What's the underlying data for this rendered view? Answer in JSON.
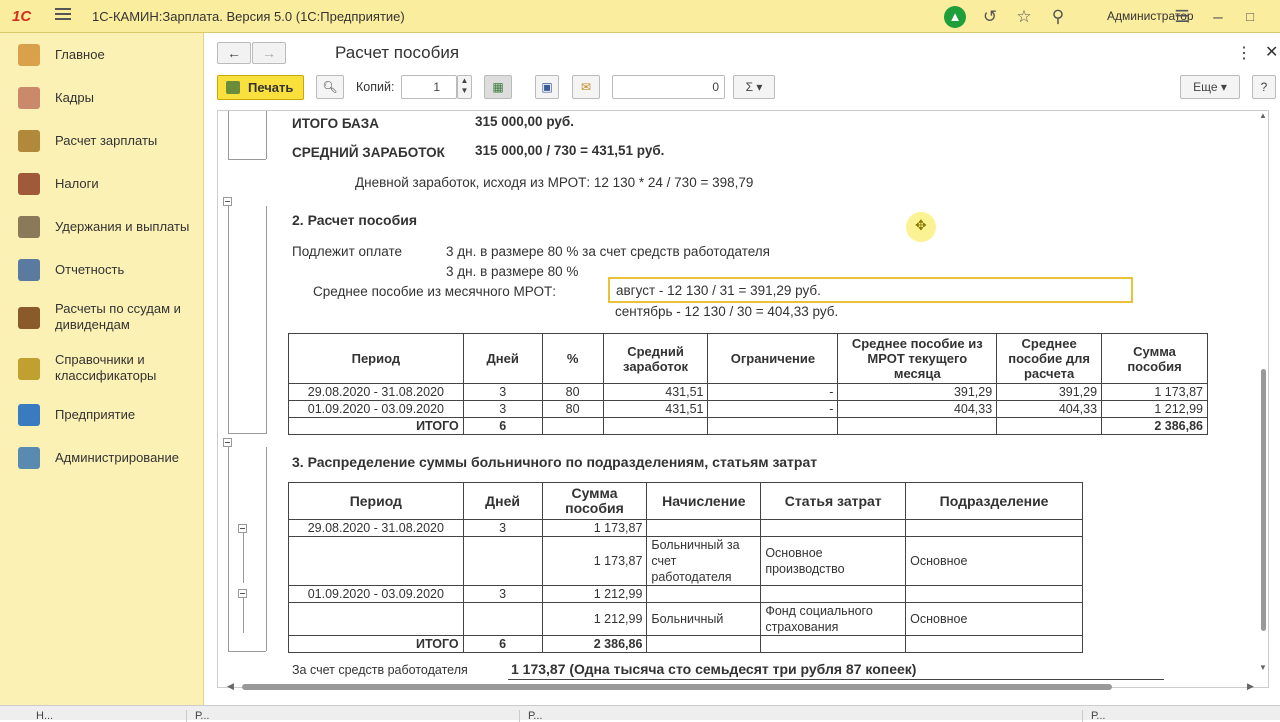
{
  "app": {
    "logo": "1С",
    "title": "1С-КАМИН:Зарплата. Версия 5.0  (1С:Предприятие)",
    "user": "Администратор"
  },
  "sidebar": {
    "items": [
      {
        "label": "Главное",
        "color": "#d9a24a"
      },
      {
        "label": "Кадры",
        "color": "#c9896a"
      },
      {
        "label": "Расчет зарплаты",
        "color": "#b08a3a"
      },
      {
        "label": "Налоги",
        "color": "#a05a3a"
      },
      {
        "label": "Удержания и выплаты",
        "color": "#8a7a5a"
      },
      {
        "label": "Отчетность",
        "color": "#5a7aa0"
      },
      {
        "label": "Расчеты по ссудам и дивидендам",
        "color": "#8a5a2a"
      },
      {
        "label": "Справочники и классификаторы",
        "color": "#c0a030"
      },
      {
        "label": "Предприятие",
        "color": "#3a7ac0"
      },
      {
        "label": "Администрирование",
        "color": "#5a8ab0"
      }
    ]
  },
  "form": {
    "title": "Расчет пособия",
    "print_label": "Печать",
    "copies_label": "Копий:",
    "copies_value": "1",
    "sum_value": "0",
    "more_label": "Еще",
    "help_label": "?"
  },
  "doc": {
    "base_label": "ИТОГО БАЗА",
    "base_value": "315 000,00  руб.",
    "avg_label": "СРЕДНИЙ ЗАРАБОТОК",
    "avg_value": "315 000,00  /  730  =  431,51  руб.",
    "daily": "Дневной заработок, исходя из МРОТ: 12 130 * 24 / 730 = 398,79",
    "sec2": "2. Расчет пособия",
    "pay_label": "Подлежит оплате",
    "pay_line1": "3 дн. в размере 80 % за счет средств работодателя",
    "pay_line2": "3 дн. в размере 80 %",
    "mrot_label": "Среднее пособие из месячного МРОТ:",
    "mrot_line1": "август - 12 130 / 31 = 391,29 руб.",
    "mrot_line2": "сентябрь - 12 130 / 30 = 404,33 руб.",
    "t1_headers": [
      "Период",
      "Дней",
      "%",
      "Средний заработок",
      "Ограничение",
      "Среднее пособие из МРОТ текущего месяца",
      "Среднее пособие для расчета",
      "Сумма пособия"
    ],
    "t1_rows": [
      [
        "29.08.2020 - 31.08.2020",
        "3",
        "80",
        "431,51",
        "-",
        "391,29",
        "391,29",
        "1 173,87"
      ],
      [
        "01.09.2020 - 03.09.2020",
        "3",
        "80",
        "431,51",
        "-",
        "404,33",
        "404,33",
        "1 212,99"
      ]
    ],
    "t1_total": {
      "label": "ИТОГО",
      "days": "6",
      "sum": "2 386,86"
    },
    "sec3": "3. Распределение суммы больничного по подразделениям, статьям затрат",
    "t2_headers": [
      "Период",
      "Дней",
      "Сумма пособия",
      "Начисление",
      "Статья затрат",
      "Подразделение"
    ],
    "t2_rows": [
      [
        "29.08.2020 - 31.08.2020",
        "3",
        "1 173,87",
        "",
        "",
        ""
      ],
      [
        "",
        "",
        "1 173,87",
        "Больничный за счет работодателя",
        "Основное производство",
        "Основное"
      ],
      [
        "01.09.2020 - 03.09.2020",
        "3",
        "1 212,99",
        "",
        "",
        ""
      ],
      [
        "",
        "",
        "1 212,99",
        "Больничный",
        "Фонд социального страхования",
        "Основное"
      ]
    ],
    "t2_total": {
      "label": "ИТОГО",
      "days": "6",
      "sum": "2 386,86"
    },
    "employer_label": "За счет средств работодателя",
    "employer_value": "1 173,87 (Одна тысяча сто семьдесят три рубля 87 копеек)"
  },
  "status": [
    "Н...",
    "Р...",
    "Р...",
    "Р..."
  ]
}
